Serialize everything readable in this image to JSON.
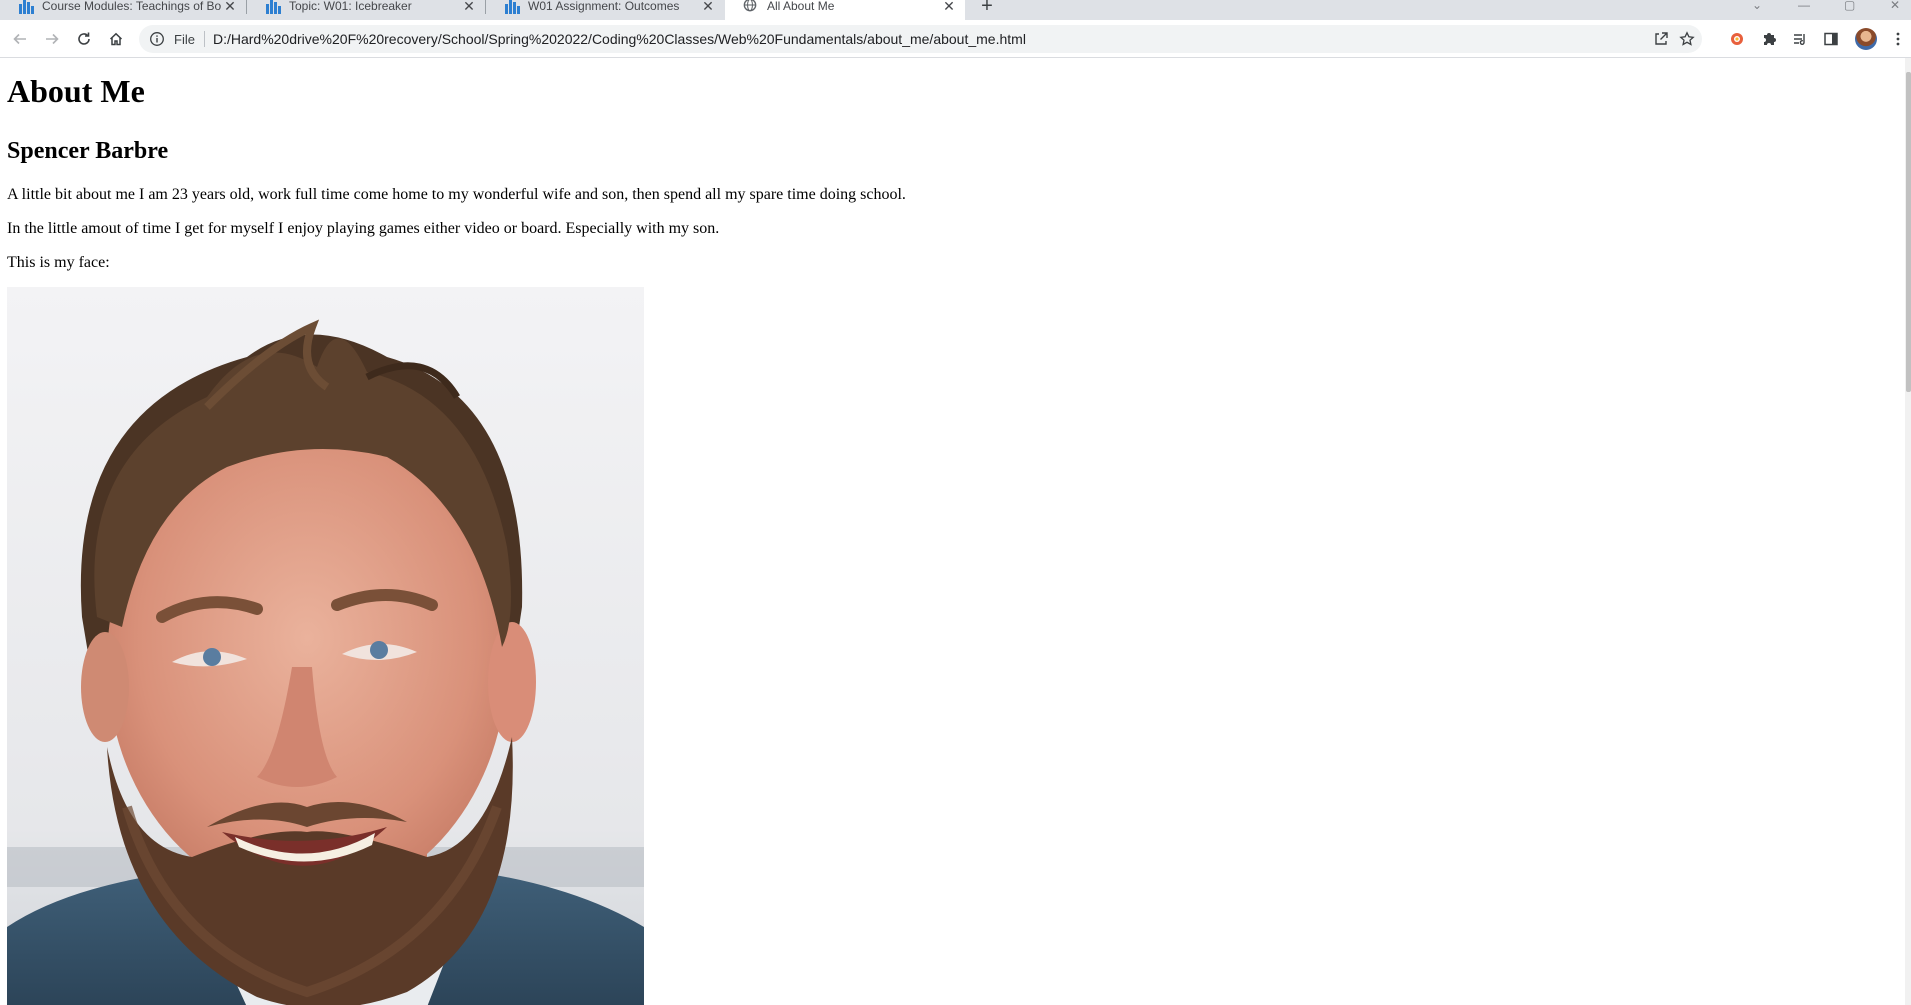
{
  "tabs": [
    {
      "title": "Course Modules: Teachings of Bo",
      "icon": "canvas-logo-icon"
    },
    {
      "title": "Topic: W01: Icebreaker",
      "icon": "canvas-logo-icon"
    },
    {
      "title": "W01 Assignment: Outcomes",
      "icon": "canvas-logo-icon"
    },
    {
      "title": "All About Me",
      "icon": "globe-icon"
    }
  ],
  "address_bar": {
    "scheme_label": "File",
    "url": "D:/Hard%20drive%20F%20recovery/School/Spring%202022/Coding%20Classes/Web%20Fundamentals/about_me/about_me.html"
  },
  "page": {
    "heading": "About Me",
    "subheading": "Spencer Barbre",
    "paragraph1": "A little bit about me I am 23 years old, work full time come home to my wonderful wife and son, then spend all my spare time doing school.",
    "paragraph2": "In the little amout of time I get for myself I enjoy playing games either video or board. Especially with my son.",
    "paragraph3": "This is my face:"
  },
  "colors": {
    "tabstrip_bg": "#dee1e6",
    "omnibox_bg": "#f1f3f4",
    "canvas_blue": "#2d7fd1"
  }
}
